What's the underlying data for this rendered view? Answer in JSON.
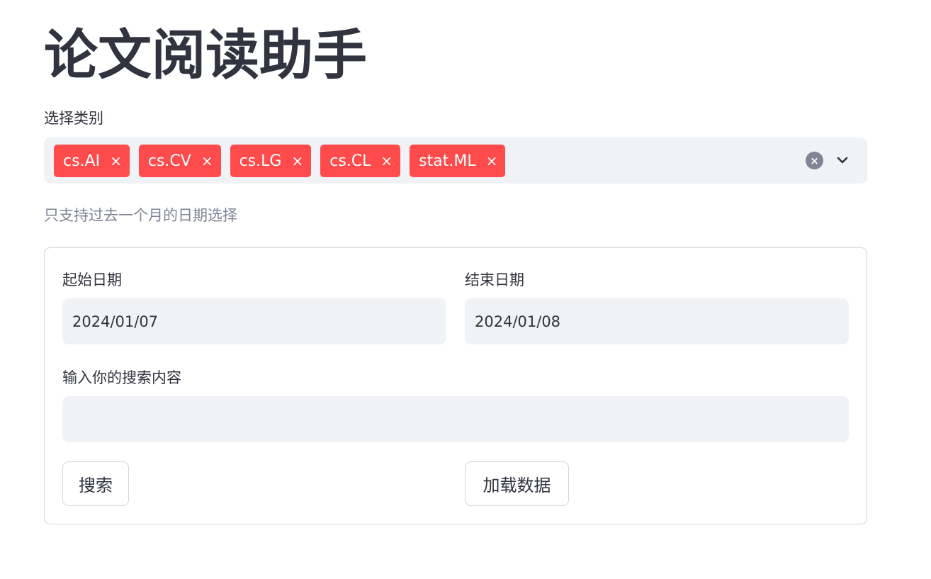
{
  "page": {
    "title": "论文阅读助手"
  },
  "category_select": {
    "label": "选择类别",
    "selected": [
      "cs.AI",
      "cs.CV",
      "cs.LG",
      "cs.CL",
      "stat.ML"
    ],
    "remove_glyph": "×",
    "clear_glyph": "×",
    "clear_icon": "clear-all-icon",
    "dropdown_icon": "chevron-down-icon"
  },
  "date_caption": "只支持过去一个月的日期选择",
  "form": {
    "start_date": {
      "label": "起始日期",
      "value": "2024/01/07"
    },
    "end_date": {
      "label": "结束日期",
      "value": "2024/01/08"
    },
    "search": {
      "label": "输入你的搜索内容",
      "value": "",
      "placeholder": ""
    },
    "search_button_label": "搜索",
    "load_button_label": "加载数据"
  },
  "colors": {
    "accent": "#ff4b4b",
    "input_bg": "#f0f2f6",
    "text": "#31333f",
    "muted": "#808495",
    "border": "#d6d6d9"
  }
}
